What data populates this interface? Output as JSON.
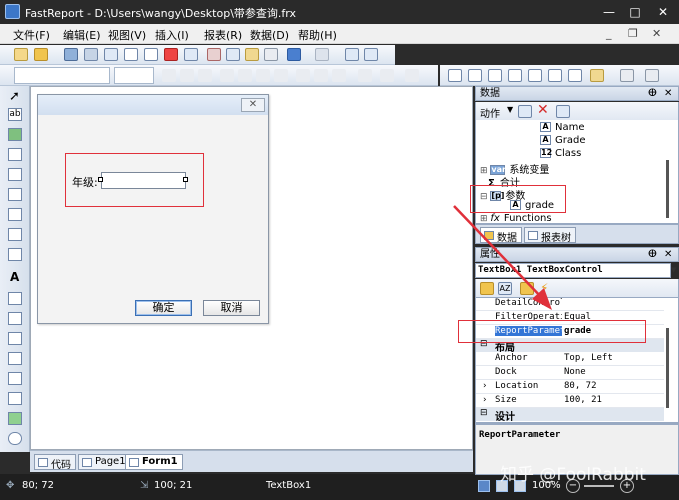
{
  "window": {
    "title": "FastReport - D:\\Users\\wangy\\Desktop\\带参查询.frx",
    "minimize": "—",
    "maximize": "□",
    "close": "✕"
  },
  "menu": {
    "items": [
      "文件(F)",
      "编辑(E)",
      "视图(V)",
      "插入(I)",
      "报表(R)",
      "数据(D)",
      "帮助(H)"
    ],
    "mdi_minimize": "_",
    "mdi_restore": "❐",
    "mdi_close": "✕"
  },
  "dialog": {
    "close_glyph": "✕",
    "grade_label": "年级:",
    "ok_label": "确定",
    "cancel_label": "取消"
  },
  "bottom_tabs": [
    "代码",
    "Page1",
    "Form1"
  ],
  "status": {
    "position": "80; 72",
    "size": "100; 21",
    "object": "TextBox1"
  },
  "data_panel": {
    "title": "数据",
    "pin": "ⴲ",
    "close": "✕",
    "action_label": "动作",
    "tree": [
      {
        "label": "Name",
        "icon": "A",
        "indent": 64
      },
      {
        "label": "Grade",
        "icon": "A",
        "indent": 64
      },
      {
        "label": "Class",
        "icon": "12",
        "indent": 64
      },
      {
        "label": "系统变量",
        "icon": "var",
        "indent": 8
      },
      {
        "label": "合计",
        "icon": "Σ",
        "indent": 8
      },
      {
        "label": "参数",
        "icon": "p",
        "indent": 8
      },
      {
        "label": "grade",
        "icon": "A",
        "indent": 22
      },
      {
        "label": "Functions",
        "icon": "fx",
        "indent": 8
      }
    ],
    "tabs": [
      "数据",
      "报表树"
    ]
  },
  "prop_panel": {
    "title": "属性",
    "pin": "ⴲ",
    "close": "✕",
    "object_select": "TextBox1 TextBoxControl",
    "rows": [
      {
        "type": "prop",
        "name": "DetailControl",
        "value": ""
      },
      {
        "type": "prop",
        "name": "FilterOperation",
        "value": "Equal"
      },
      {
        "type": "prop",
        "name": "ReportParameter",
        "value": "grade",
        "selected": true
      },
      {
        "type": "cat",
        "name": "布局"
      },
      {
        "type": "prop",
        "name": "Anchor",
        "value": "Top, Left"
      },
      {
        "type": "prop",
        "name": "Dock",
        "value": "None"
      },
      {
        "type": "prop",
        "name": "Location",
        "value": "80, 72",
        "expandable": true
      },
      {
        "type": "prop",
        "name": "Size",
        "value": "100, 21",
        "expandable": true
      },
      {
        "type": "cat",
        "name": "设计"
      }
    ],
    "description": "ReportParameter",
    "zoom": "100%"
  },
  "watermark": "知乎 @FoolRabbit",
  "colors": {
    "highlight": "#e0303a",
    "selection": "#3375d6"
  }
}
